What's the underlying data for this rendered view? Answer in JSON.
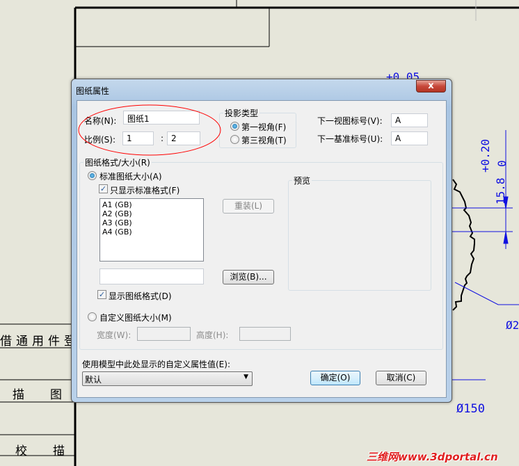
{
  "background": {
    "table_cells": [
      "借通用件登记",
      "描　图",
      "校　描"
    ],
    "dimensions": [
      "+0.05",
      "+0.20",
      "0",
      "15.8",
      "Ø2",
      "Ø150"
    ],
    "watermark": "三维网www.3dportal.cn",
    "annotation_color": "#ff0000"
  },
  "dialog": {
    "title": "图纸属性",
    "close_label": "x",
    "name_label": "名称(N):",
    "name_value": "图纸1",
    "scale_label": "比例(S):",
    "scale_num": "1",
    "scale_sep": ":",
    "scale_den": "2",
    "projection": {
      "legend": "投影类型",
      "options": [
        {
          "label": "第一视角(F)",
          "selected": true
        },
        {
          "label": "第三视角(T)",
          "selected": false
        }
      ]
    },
    "next_view_label": "下一视图标号(V):",
    "next_view_value": "A",
    "next_datum_label": "下一基准标号(U):",
    "next_datum_value": "A",
    "format": {
      "legend": "图纸格式/大小(R)",
      "standard_label": "标准图纸大小(A)",
      "standard_selected": true,
      "only_standard_label": "只显示标准格式(F)",
      "only_standard_checked": true,
      "sizes": [
        "A1 (GB)",
        "A2 (GB)",
        "A3 (GB)",
        "A4 (GB)"
      ],
      "reload_label": "重装(L)",
      "path_value": "",
      "browse_label": "浏览(B)...",
      "show_format_label": "显示图纸格式(D)",
      "show_format_checked": true,
      "custom_label": "自定义图纸大小(M)",
      "custom_selected": false,
      "width_label": "宽度(W):",
      "width_value": "",
      "height_label": "高度(H):",
      "height_value": "",
      "preview_label": "预览"
    },
    "custom_prop_label": "使用模型中此处显示的自定义属性值(E):",
    "custom_prop_value": "默认",
    "ok_label": "确定(O)",
    "cancel_label": "取消(C)"
  }
}
